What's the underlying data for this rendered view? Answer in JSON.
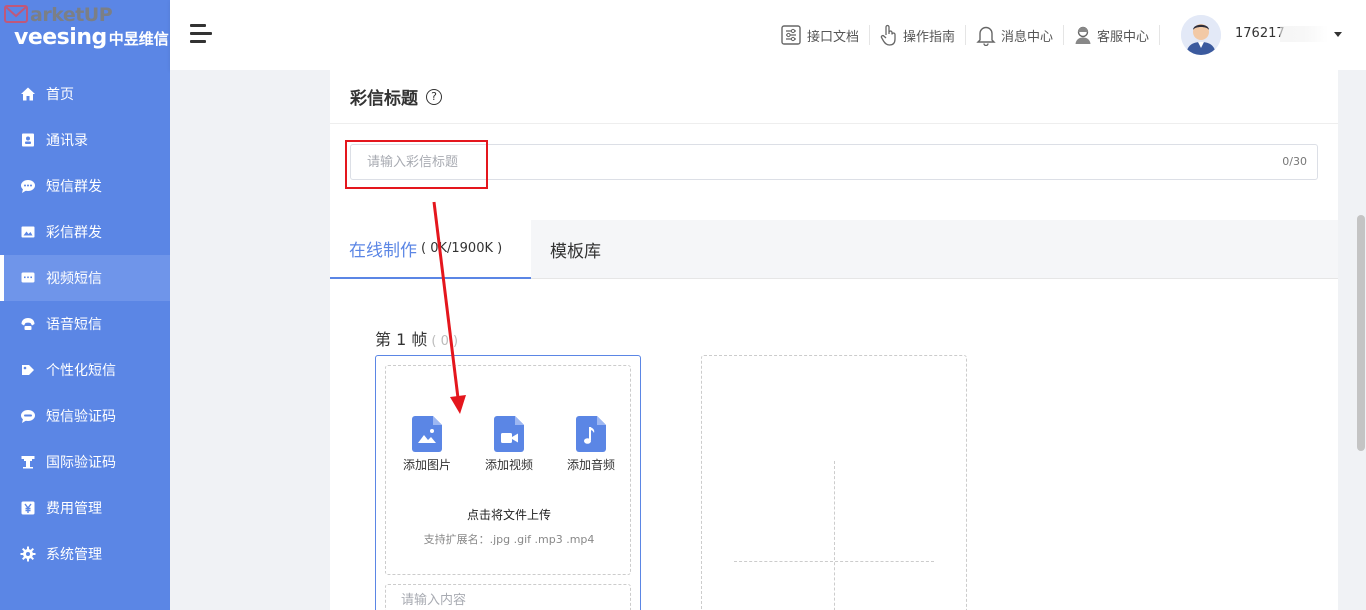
{
  "watermark": "arketUP",
  "brand": {
    "name": "veesing",
    "name_cn": "中昱维信"
  },
  "sidebar": {
    "items": [
      {
        "label": "首页",
        "icon": "home-icon"
      },
      {
        "label": "通讯录",
        "icon": "contacts-icon"
      },
      {
        "label": "短信群发",
        "icon": "sms-icon"
      },
      {
        "label": "彩信群发",
        "icon": "mms-icon"
      },
      {
        "label": "视频短信",
        "icon": "video-sms-icon",
        "active": true
      },
      {
        "label": "语音短信",
        "icon": "voice-icon"
      },
      {
        "label": "个性化短信",
        "icon": "personalized-icon"
      },
      {
        "label": "短信验证码",
        "icon": "verification-icon"
      },
      {
        "label": "国际验证码",
        "icon": "international-icon"
      },
      {
        "label": "费用管理",
        "icon": "yen-icon"
      },
      {
        "label": "系统管理",
        "icon": "gear-icon"
      }
    ]
  },
  "header": {
    "links": [
      {
        "label": "接口文档",
        "icon": "api-doc-icon"
      },
      {
        "label": "操作指南",
        "icon": "hand-pointer-icon"
      },
      {
        "label": "消息中心",
        "icon": "bell-icon"
      },
      {
        "label": "客服中心",
        "icon": "customer-service-icon"
      }
    ],
    "phone": "176217"
  },
  "title_section": {
    "heading": "彩信标题",
    "help": "?",
    "placeholder": "请输入彩信标题",
    "counter": "0/30"
  },
  "tabs": {
    "online": "在线制作",
    "size": "( 0K/1900K )",
    "template": "模板库"
  },
  "frame": {
    "label": "第 1 帧",
    "count": "( 0 )",
    "add_image": "添加图片",
    "add_video": "添加视频",
    "add_audio": "添加音频",
    "upload_hint": "点击将文件上传",
    "extensions": "支持扩展名：.jpg .gif .mp3 .mp4",
    "content_placeholder": "请输入内容"
  },
  "colors": {
    "sidebar": "#5b86e5",
    "accent": "#5b86e5",
    "highlight": "#e4161d"
  }
}
